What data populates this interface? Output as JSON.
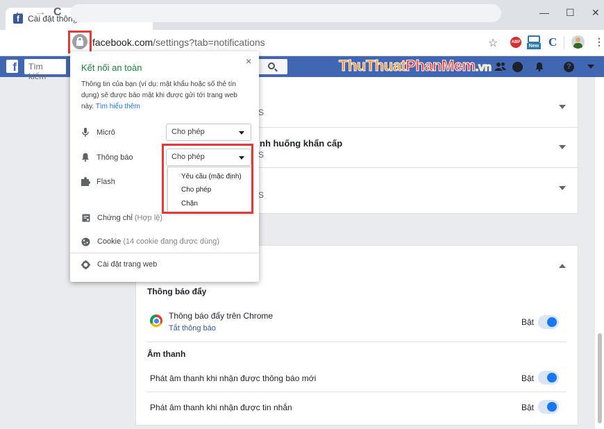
{
  "browser": {
    "tab_title": "Cài đặt thông báo",
    "tab_close": "×",
    "new_tab": "+",
    "minimize": "—",
    "maximize": "☐",
    "close": "✕",
    "back": "←",
    "forward": "→",
    "reload": "C",
    "url_host": "facebook.com",
    "url_path": "/settings?tab=notifications",
    "star": "☆",
    "ext_abp": "ABP",
    "ext_new": "New",
    "ext_c": "C",
    "menu": "⋮"
  },
  "facebook": {
    "logo": "f",
    "search_placeholder": "Tìm kiếm",
    "watermark_part1": "ThuThuat",
    "watermark_part2": "PhanMem",
    "watermark_part3": ".vn"
  },
  "site_info": {
    "close": "×",
    "title": "Kết nối an toàn",
    "desc": "Thông tin của bạn (ví dụ: mật khẩu hoặc số thẻ tín dụng) sẽ được bảo mật khi được gửi tới trang web này.",
    "learn_more": "Tìm hiểu thêm",
    "permissions": [
      {
        "label": "Micrô",
        "value": "Cho phép"
      },
      {
        "label": "Thông báo",
        "value": "Cho phép"
      },
      {
        "label": "Flash"
      }
    ],
    "dropdown_options": [
      "Yêu cầu (mặc định)",
      "Cho phép",
      "Chặn"
    ],
    "links": [
      {
        "label": "Chứng chỉ",
        "note": "(Hợp lệ)"
      },
      {
        "label": "Cookie",
        "note": "(14 cookie đang được dùng)"
      },
      {
        "label": "Cài đặt trang web",
        "note": ""
      }
    ]
  },
  "settings": {
    "row_fragment_1": "S",
    "row_fragment_2_title": "nh huống khẩn cấp",
    "row_fragment_2_sub": "S",
    "row_fragment_3": "S",
    "push_section": "Thông báo đẩy",
    "chrome_push_label": "Thông báo đẩy trên Chrome",
    "chrome_push_link": "Tắt thông báo",
    "chrome_push_state": "Bật",
    "sound_section": "Âm thanh",
    "sound_new_notif_label": "Phát âm thanh khi nhận được thông báo mới",
    "sound_new_notif_state": "Bật",
    "sound_message_label": "Phát âm thanh khi nhận được tin nhắn",
    "sound_message_state": "Bật"
  },
  "colors": {
    "fb_blue": "#4267b2",
    "secure_green": "#188038",
    "highlight_red": "#e53935",
    "toggle_blue": "#1877f2"
  }
}
